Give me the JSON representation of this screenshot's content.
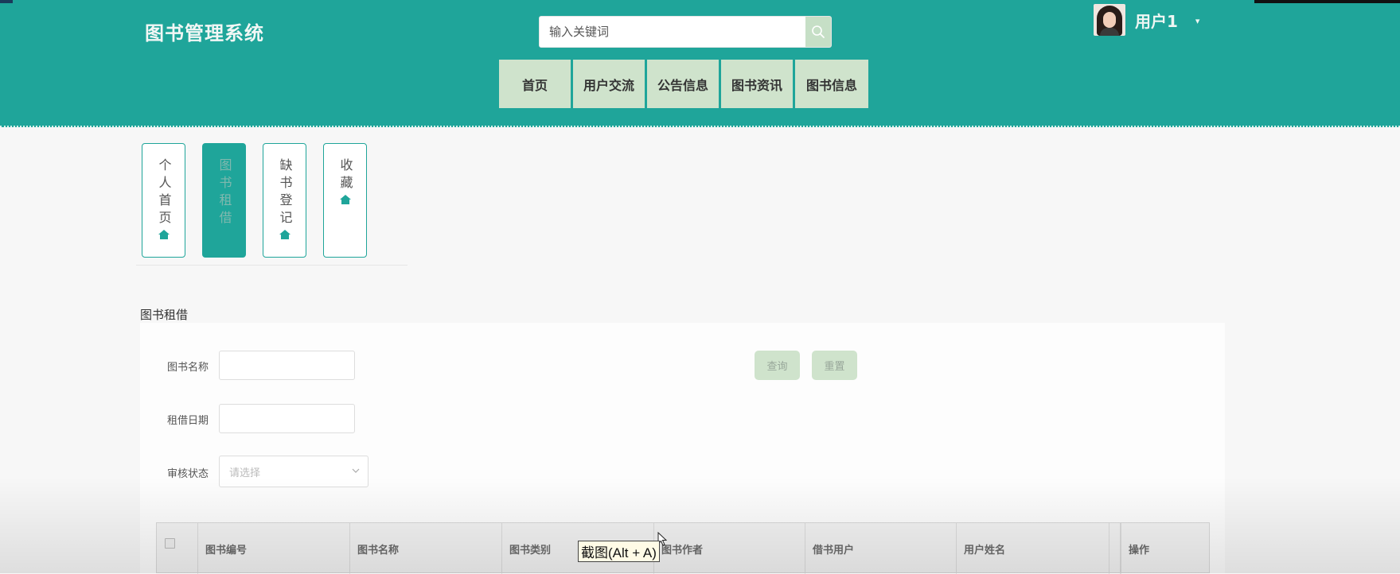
{
  "header": {
    "title": "图书管理系统",
    "search": {
      "placeholder": "输入关键词"
    },
    "user": {
      "name": "用户1"
    },
    "nav": [
      {
        "label": "首页"
      },
      {
        "label": "用户交流"
      },
      {
        "label": "公告信息"
      },
      {
        "label": "图书资讯"
      },
      {
        "label": "图书信息"
      }
    ]
  },
  "tabs": [
    {
      "label": "个人首页",
      "active": false
    },
    {
      "label": "图书租借",
      "active": true
    },
    {
      "label": "缺书登记",
      "active": false
    },
    {
      "label": "收藏",
      "active": false
    }
  ],
  "section": {
    "title": "图书租借"
  },
  "form": {
    "book_name_label": "图书名称",
    "rent_date_label": "租借日期",
    "review_status_label": "审核状态",
    "review_status_placeholder": "请选择",
    "query_button": "查询",
    "reset_button": "重置"
  },
  "table": {
    "columns": [
      "图书编号",
      "图书名称",
      "图书类别",
      "图书作者",
      "借书用户",
      "用户姓名",
      "操作"
    ]
  },
  "tooltip": {
    "text": "截图(Alt + A)"
  },
  "colors": {
    "primary": "#1fa59a",
    "nav_bg": "#cfe3cc"
  }
}
